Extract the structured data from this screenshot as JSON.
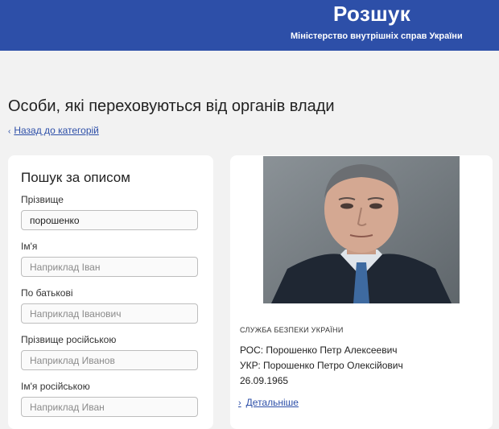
{
  "header": {
    "title": "Розшук",
    "subtitle": "Міністерство внутрішніх справ України"
  },
  "page": {
    "title": "Особи, які переховуються від органів влади",
    "back_link": "Назад до категорій"
  },
  "search": {
    "heading": "Пошук за описом",
    "fields": [
      {
        "label": "Прізвище",
        "value": "порошенко",
        "placeholder": ""
      },
      {
        "label": "Ім'я",
        "value": "",
        "placeholder": "Наприклад Іван"
      },
      {
        "label": "По батькові",
        "value": "",
        "placeholder": "Наприклад Іванович"
      },
      {
        "label": "Прізвище російською",
        "value": "",
        "placeholder": "Наприклад Иванов"
      },
      {
        "label": "Ім'я російською",
        "value": "",
        "placeholder": "Наприклад Иван"
      }
    ]
  },
  "result": {
    "agency": "СЛУЖБА БЕЗПЕКИ УКРАЇНИ",
    "name_ru": "РОС: Порошенко Петр Алексеевич",
    "name_ua": "УКР: Порошенко Петро Олексійович",
    "birth_date": "26.09.1965",
    "details_link": "Детальніше"
  }
}
